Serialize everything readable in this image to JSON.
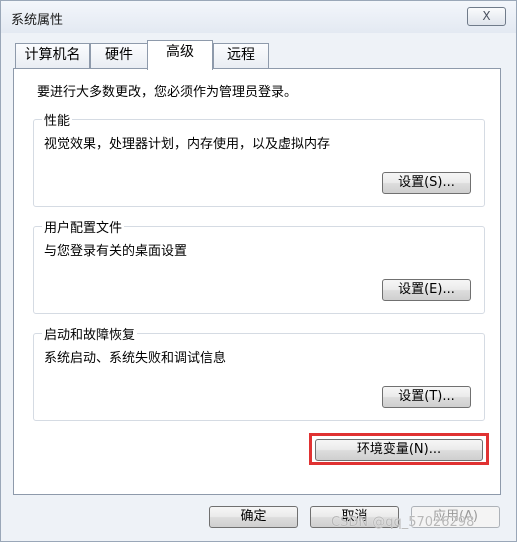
{
  "window": {
    "title": "系统属性",
    "close_label": "X"
  },
  "tabs": [
    {
      "label": "计算机名"
    },
    {
      "label": "硬件"
    },
    {
      "label": "高级"
    },
    {
      "label": "远程"
    }
  ],
  "active_tab": "高级",
  "intro_text": "要进行大多数更改，您必须作为管理员登录。",
  "groups": {
    "performance": {
      "label": "性能",
      "description": "视觉效果，处理器计划，内存使用，以及虚拟内存",
      "button": "设置(S)..."
    },
    "user_profiles": {
      "label": "用户配置文件",
      "description": "与您登录有关的桌面设置",
      "button": "设置(E)..."
    },
    "startup_recovery": {
      "label": "启动和故障恢复",
      "description": "系统启动、系统失败和调试信息",
      "button": "设置(T)..."
    }
  },
  "env_button": "环境变量(N)...",
  "footer": {
    "ok": "确定",
    "cancel": "取消",
    "apply": "应用(A)"
  },
  "watermark": "CSDN @qq_57026298",
  "colors": {
    "highlight": "#e03232",
    "window_bg": "#eef2f7"
  }
}
